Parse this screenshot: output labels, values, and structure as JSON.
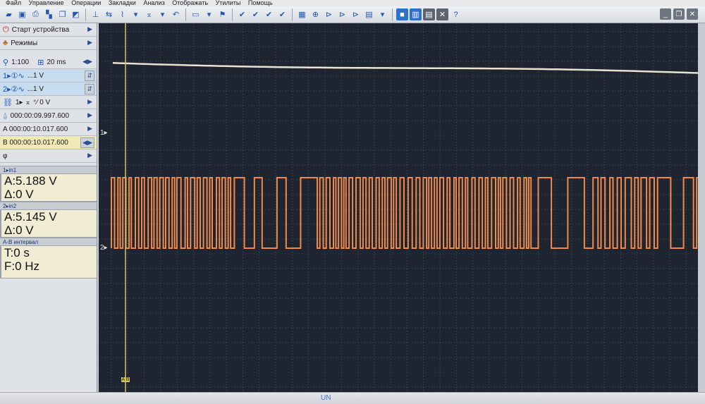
{
  "menu": [
    "Файл",
    "Управление",
    "Операции",
    "Закладки",
    "Анализ",
    "Отображать",
    "Утилиты",
    "Помощь"
  ],
  "left_panel": {
    "start_device": "Старт устройства",
    "modes": "Режимы",
    "probe": "1:100",
    "timebase": "20 ms",
    "ch1_setting": "...1 V",
    "ch2_setting": "...1 V",
    "trigger": "1▸ ⌅ ⁺∕ 0 V",
    "delay": "000:00:09.997.600",
    "cursor_a": "A 000:00:10.017.600",
    "cursor_b": "B 000:00:10.017.600",
    "phase": "φ"
  },
  "ch1": {
    "title": "1▸in1",
    "a": "A:5.188 V",
    "delta": "Δ:0 V"
  },
  "ch2": {
    "title": "2▸in2",
    "a": "A:5.145 V",
    "delta": "Δ:0 V"
  },
  "interval": {
    "title": "A-B интервал",
    "t": "T:0 s",
    "f": "F:0 Hz"
  },
  "scope": {
    "marker1": "1▸",
    "marker2": "2▸",
    "cursor_label": "A B",
    "colors": {
      "bg": "#1e2430",
      "grid": "#6a7080",
      "trace1": "#eae3d2",
      "trace2": "#f08a4b",
      "cursor": "#d9c35a"
    }
  },
  "bottom_mark": "UN"
}
